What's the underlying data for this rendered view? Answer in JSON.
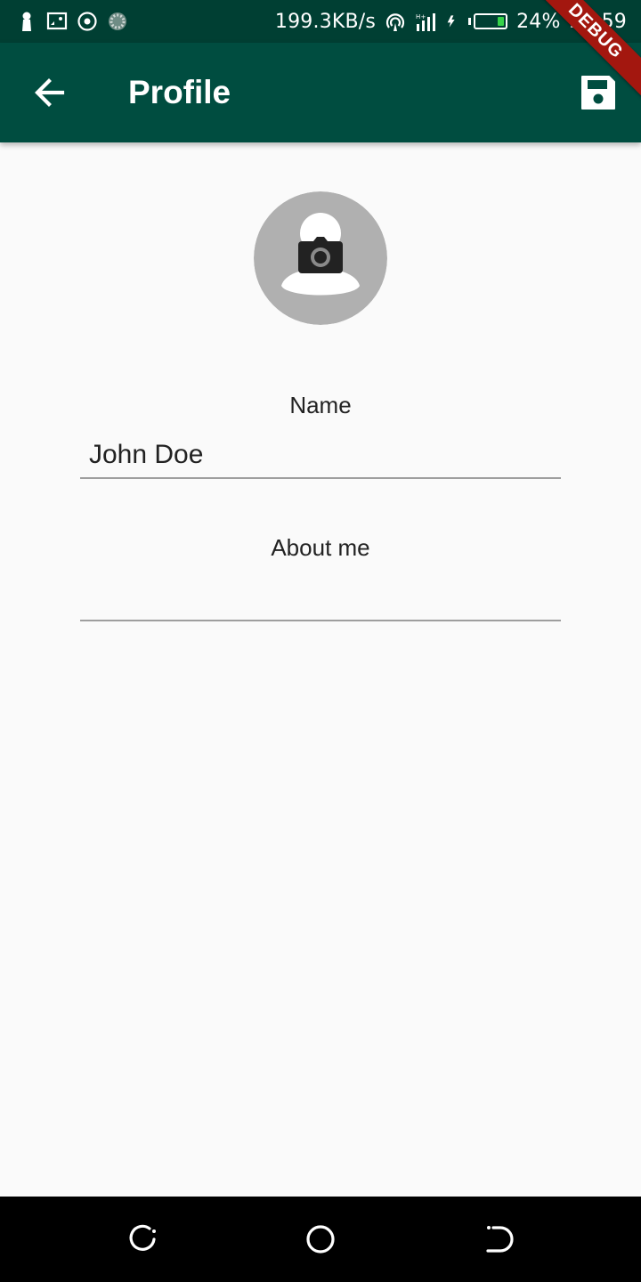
{
  "status_bar": {
    "network_speed": "199.3KB/s",
    "battery_percent": "24%",
    "battery_level": 0.24,
    "time": "23:59",
    "icons_left": [
      "person-icon",
      "cast-icon",
      "target-icon",
      "loading-icon"
    ],
    "icons_right": [
      "hotspot-icon",
      "signal-icon",
      "charging-icon",
      "battery-icon"
    ]
  },
  "app_bar": {
    "title": "Profile",
    "back_icon": "arrow-back-icon",
    "save_icon": "floppy-disk-icon"
  },
  "debug_banner": "DEBUG",
  "avatar": {
    "icon": "camera-icon"
  },
  "form": {
    "name_label": "Name",
    "name_value": "John Doe",
    "about_label": "About me",
    "about_value": ""
  },
  "colors": {
    "status_bar": "#003f33",
    "app_bar": "#004d40",
    "background": "#fafafa",
    "avatar_bg": "#b0b0b0",
    "debug": "#a3170f",
    "battery_fill": "#35d24a"
  },
  "nav_bar": {
    "icons": [
      "recent-apps-icon",
      "home-icon",
      "back-icon"
    ]
  }
}
